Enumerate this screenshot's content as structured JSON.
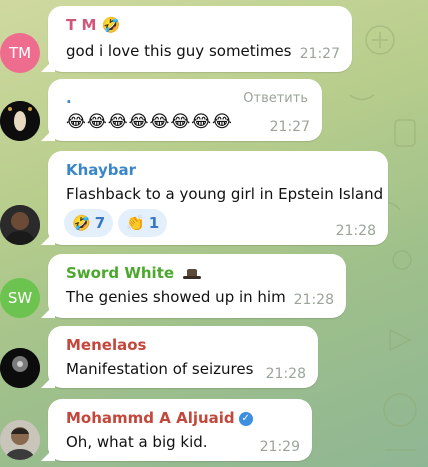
{
  "colors": {
    "tm_avatar": "#ee6d8f",
    "sw_avatar": "#6cc34f",
    "name_tm": "#d1577a",
    "name_blue": "#3a86c8",
    "name_green": "#4aa82c",
    "name_red": "#c3473a",
    "reaction_bg": "#e3effb"
  },
  "messages": [
    {
      "avatar_initials": "TM",
      "sender": "T M",
      "sender_icon": "laughing-face-icon",
      "text": "god i love this guy sometimes",
      "time": "21:27"
    },
    {
      "sender": ".",
      "reply_label": "Ответить",
      "text": "😂😂😂😂😂😂😂😂",
      "time": "21:27"
    },
    {
      "sender": "Khaybar",
      "text": "Flashback to a young girl in Epstein Island",
      "reactions": [
        {
          "icon": "rofl-icon",
          "emoji": "🤣",
          "count": "7"
        },
        {
          "icon": "clapping-hands-icon",
          "emoji": "👏",
          "count": "1"
        }
      ],
      "time": "21:28"
    },
    {
      "avatar_initials": "SW",
      "sender": "Sword White",
      "sender_icon": "hat-icon",
      "text": "The genies showed up in him",
      "time": "21:28"
    },
    {
      "sender": "Menelaos",
      "text": "Manifestation of seizures",
      "time": "21:28"
    },
    {
      "sender": "Mohammd A Aljuaid",
      "sender_icon": "verified-check-icon",
      "text": "Oh, what a big kid.",
      "time": "21:29"
    }
  ]
}
